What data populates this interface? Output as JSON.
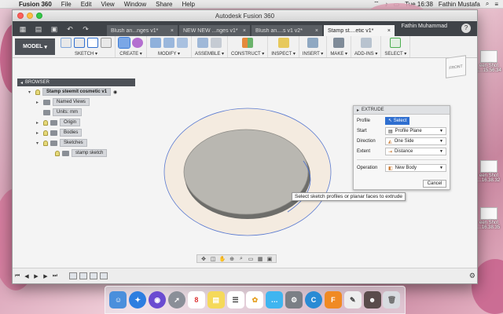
{
  "menubar": {
    "app": "Fusion 360",
    "items": [
      "File",
      "Edit",
      "View",
      "Window",
      "Share",
      "Help"
    ],
    "clock": "Tue 16:38",
    "user": "Fathin Mustafa"
  },
  "window": {
    "title": "Autodesk Fusion 360",
    "user_name": "Fathin Muhammad",
    "help_glyph": "?",
    "tabs": [
      {
        "label": "Blush an...nges v1*"
      },
      {
        "label": "NEW NEW ...nges v1*"
      },
      {
        "label": "Blush an....s v1 v2*"
      },
      {
        "label": "Stamp st....etic v1*"
      }
    ]
  },
  "ribbon": {
    "workspace": "MODEL",
    "groups": [
      {
        "label": "SKETCH ▾"
      },
      {
        "label": "CREATE ▾"
      },
      {
        "label": "MODIFY ▾"
      },
      {
        "label": "ASSEMBLE ▾"
      },
      {
        "label": "CONSTRUCT ▾"
      },
      {
        "label": "INSPECT ▾"
      },
      {
        "label": "INSERT ▾"
      },
      {
        "label": "MAKE ▾"
      },
      {
        "label": "ADD-INS ▾"
      },
      {
        "label": "SELECT ▾"
      }
    ]
  },
  "browser": {
    "title": "BROWSER",
    "items": [
      {
        "label": "Stamp steemit cosmetic v1"
      },
      {
        "label": "Named Views"
      },
      {
        "label": "Units: mm"
      },
      {
        "label": "Origin"
      },
      {
        "label": "Bodies"
      },
      {
        "label": "Sketches"
      },
      {
        "label": "stamp sketch"
      }
    ]
  },
  "viewcube": {
    "label": "FRONT"
  },
  "extrude": {
    "title": "EXTRUDE",
    "profile_label": "Profile",
    "profile_button": "Select",
    "start_label": "Start",
    "start_value": "Profile Plane",
    "direction_label": "Direction",
    "direction_value": "One Side",
    "extent_label": "Extent",
    "extent_value": "Distance",
    "operation_label": "Operation",
    "operation_value": "New Body",
    "cancel_label": "Cancel"
  },
  "tooltip": "Select sketch profiles or planar faces to extrude",
  "desktop": {
    "items": [
      {
        "label": "een Shot 1...15.56.34"
      },
      {
        "label": "een Shot ...16.38.32"
      },
      {
        "label": "een Shot ...16.38.35"
      }
    ]
  },
  "dock": {
    "calendar_day": "8",
    "fusion_letter": "F"
  },
  "colors": {
    "ribbon_dark": "#3f4348",
    "accent_blue": "#2f6fd0",
    "disc_top": "#b8b6b0",
    "disc_ring": "#f2e8dc"
  }
}
